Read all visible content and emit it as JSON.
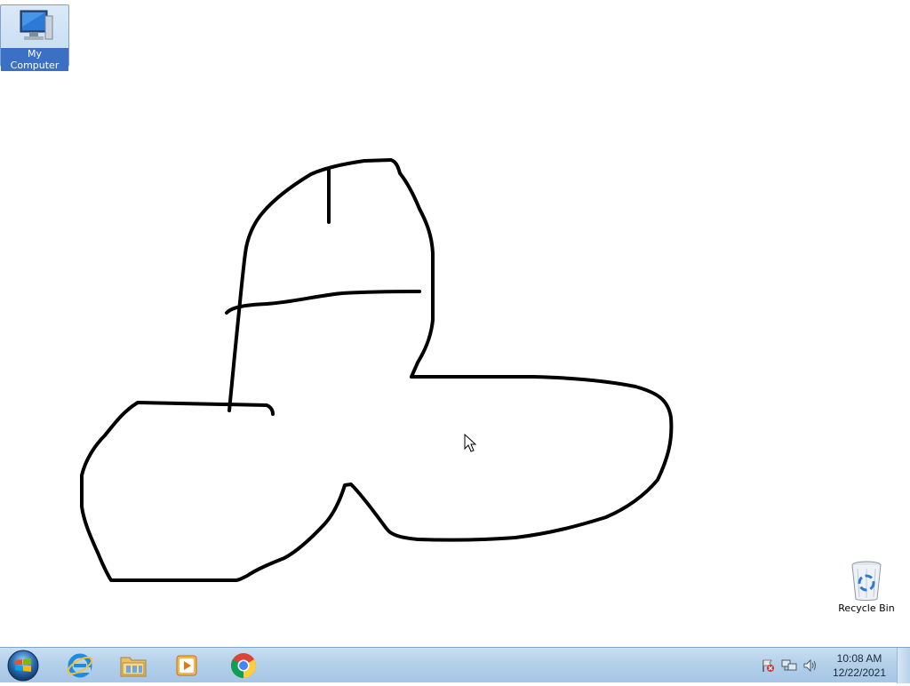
{
  "desktop": {
    "icons": [
      {
        "label": "My Computer",
        "icon": "computer-icon"
      },
      {
        "label": "Recycle Bin",
        "icon": "recycle-bin-icon"
      }
    ]
  },
  "taskbar": {
    "start_icon": "windows-start-orb-icon",
    "pinned": [
      {
        "icon": "internet-explorer-icon"
      },
      {
        "icon": "file-explorer-icon"
      },
      {
        "icon": "media-player-icon"
      },
      {
        "icon": "chrome-icon"
      }
    ],
    "tray": {
      "icons": [
        "action-center-flag-icon",
        "network-icon",
        "volume-icon"
      ],
      "time": "10:08 AM",
      "date": "12/22/2021"
    }
  },
  "colors": {
    "desktop_background": "#ffffff",
    "taskbar": "#b4d0ea",
    "stroke": "#000000"
  }
}
